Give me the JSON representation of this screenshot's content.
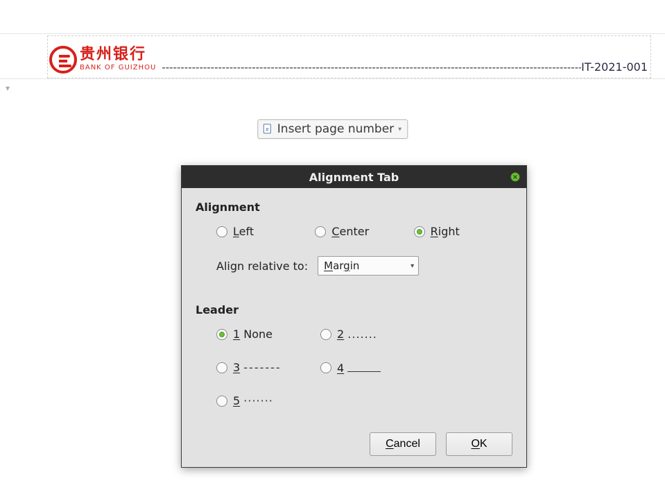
{
  "header": {
    "logo_cn": "贵州银行",
    "logo_en": "BANK OF GUIZHOU",
    "doc_number": "IT-2021-001",
    "dash_leader": "---------------------------------------------------------------------------------------------------------------------"
  },
  "toolbar": {
    "insert_page_number_label": "Insert page number"
  },
  "dialog": {
    "title": "Alignment Tab",
    "sections": {
      "alignment": {
        "title": "Alignment",
        "options": {
          "left": "Left",
          "center": "Center",
          "right": "Right"
        },
        "selected": "right",
        "relative_label": "Align relative to:",
        "relative_value": "Margin"
      },
      "leader": {
        "title": "Leader",
        "options": {
          "1": "1 None",
          "2": "2",
          "3": "3",
          "4": "4",
          "5": "5"
        },
        "samples": {
          "2": ".......",
          "3": "-------",
          "4": "______",
          "5": "·······"
        },
        "selected": "1"
      }
    },
    "buttons": {
      "cancel": "Cancel",
      "ok": "OK"
    }
  }
}
